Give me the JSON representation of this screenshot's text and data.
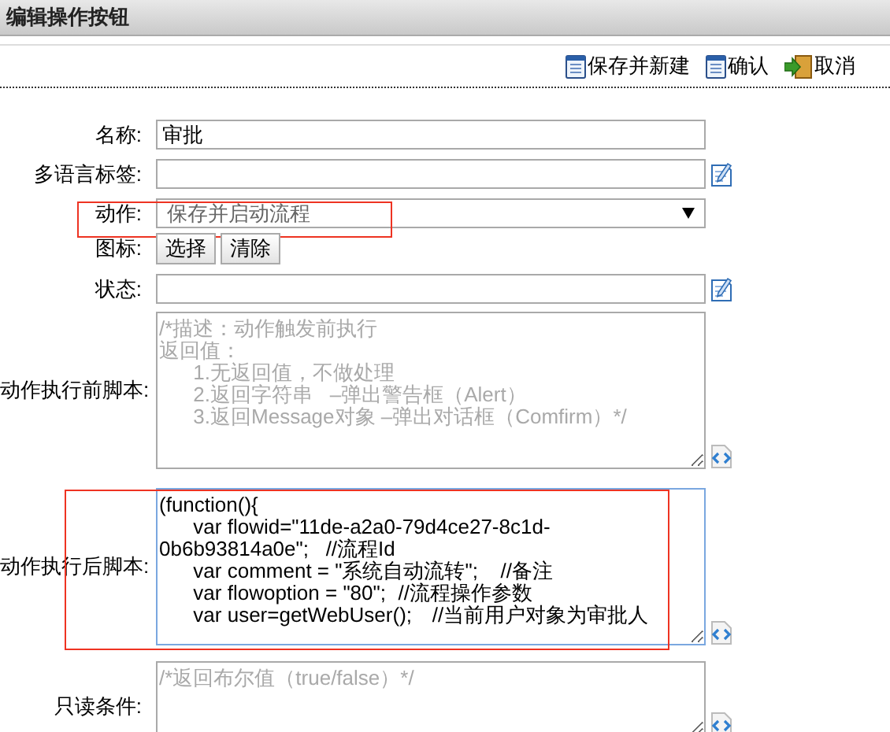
{
  "window": {
    "title": "编辑操作按钮"
  },
  "toolbar": [
    {
      "label": "保存并新建",
      "kind": "save"
    },
    {
      "label": "确认",
      "kind": "save"
    },
    {
      "label": "取消",
      "kind": "exit"
    }
  ],
  "fields": [
    {
      "label": "名称:",
      "kind": "text",
      "value": "审批"
    },
    {
      "label": "多语言标签:",
      "kind": "text"
    },
    {
      "label": "动作:",
      "kind": "select",
      "value": "保存并启动流程",
      "highlighted": true
    },
    {
      "label": "图标:",
      "kind": "buttons",
      "buttons": [
        "选择",
        "清除"
      ]
    },
    {
      "label": "状态:",
      "kind": "text"
    },
    {
      "label": "动作执行前脚本:",
      "kind": "textarea",
      "placeholder_lines": [
        "/*描述：动作触发前执行",
        "返回值：",
        "\t1.无返回值，不做处理",
        "\t2.返回字符串\t–弹出警告框（Alert）",
        "\t3.返回Message对象 –弹出对话框（Comfirm）*/"
      ]
    },
    {
      "label": "动作执行后脚本:",
      "kind": "textarea",
      "focused": true,
      "highlighted": true,
      "lines": [
        "(function(){",
        "\tvar flowid=\"11de-a2a0-79d4ce27-8c1d-0b6b93814a0e\";   //流程Id",
        "\tvar comment = \"系统自动流转\";\t//备注",
        "\tvar flowoption = \"80\";\t//流程操作参数",
        "\tvar user=getWebUser();\t//当前用户对象为审批人"
      ]
    },
    {
      "label": "只读条件:",
      "kind": "textarea",
      "placeholder_lines": [
        "/*返回布尔值（true/false）*/"
      ]
    }
  ]
}
